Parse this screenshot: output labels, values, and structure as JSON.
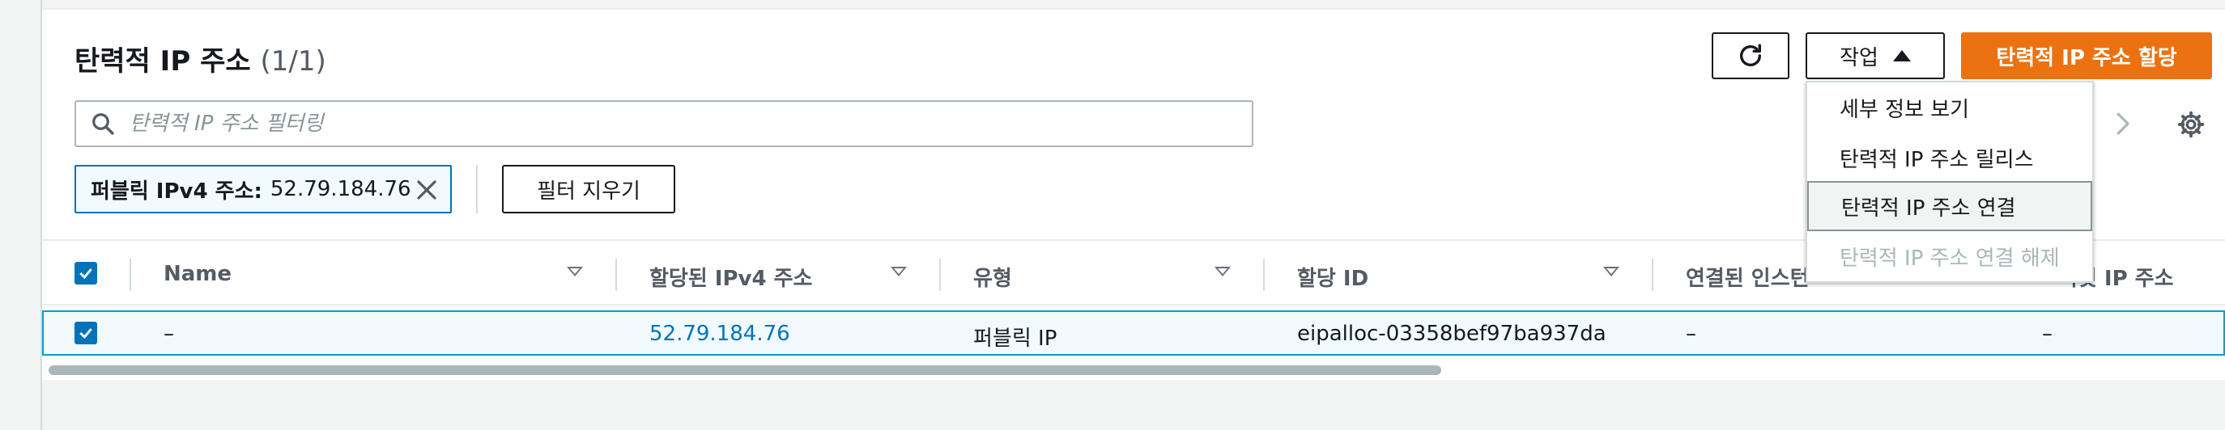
{
  "header": {
    "title": "탄력적 IP 주소",
    "count": "(1/1)",
    "actions_label": "작업",
    "allocate_label": "탄력적 IP 주소 할당"
  },
  "search": {
    "placeholder": "탄력적 IP 주소 필터링"
  },
  "filter_token": {
    "label": "퍼블릭 IPv4 주소:",
    "value": "52.79.184.76"
  },
  "clear_filters_label": "필터 지우기",
  "table": {
    "columns": [
      "Name",
      "할당된 IPv4 주소",
      "유형",
      "할당 ID",
      "연결된 인스턴",
      "비빗 IP 주소"
    ],
    "rows": [
      {
        "name": "–",
        "ipv4": "52.79.184.76",
        "type": "퍼블릭 IP",
        "allocation_id": "eipalloc-03358bef97ba937da",
        "instance": "–",
        "private_ip": "–"
      }
    ]
  },
  "actions_menu": {
    "items": [
      {
        "label": "세부 정보 보기",
        "state": "enabled"
      },
      {
        "label": "탄력적 IP 주소 릴리스",
        "state": "enabled"
      },
      {
        "label": "탄력적 IP 주소 연결",
        "state": "hovered"
      },
      {
        "label": "탄력적 IP 주소 연결 해제",
        "state": "disabled"
      }
    ]
  },
  "colors": {
    "primary": "#ec7211",
    "link": "#0073bb",
    "selected_row_bg": "#f1faff",
    "selected_row_border": "#00a1c9"
  }
}
